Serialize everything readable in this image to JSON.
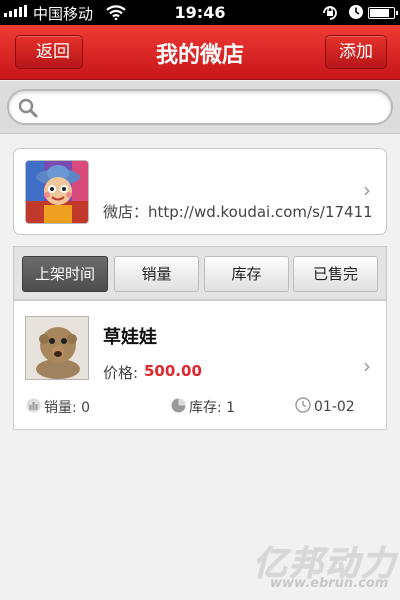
{
  "status_bar": {
    "carrier": "中国移动",
    "time": "19:46",
    "battery_level": 0.85,
    "icons": [
      "signal-icon",
      "wifi-icon",
      "rotation-lock-icon",
      "alarm-icon",
      "battery-icon"
    ]
  },
  "nav": {
    "title": "我的微店",
    "back_label": "返回",
    "add_label": "添加"
  },
  "search": {
    "placeholder": "",
    "value": ""
  },
  "shop": {
    "url_label": "微店：http://wd.koudai.com/s/17411",
    "avatar_icon": "doll-avatar"
  },
  "tabs": [
    {
      "label": "上架时间",
      "active": true
    },
    {
      "label": "销量",
      "active": false
    },
    {
      "label": "库存",
      "active": false
    },
    {
      "label": "已售完",
      "active": false
    }
  ],
  "products": [
    {
      "name": "草娃娃",
      "price_label": "价格:",
      "price": "500.00",
      "sales": "销量: 0",
      "stock": "库存: 1",
      "date": "01-02"
    }
  ],
  "watermark": {
    "logo": "亿邦动力",
    "url": "www.ebrun.com"
  },
  "colors": {
    "brand_red": "#d9221f",
    "price_red": "#e0262e",
    "tab_active": "#5a5a5a"
  }
}
